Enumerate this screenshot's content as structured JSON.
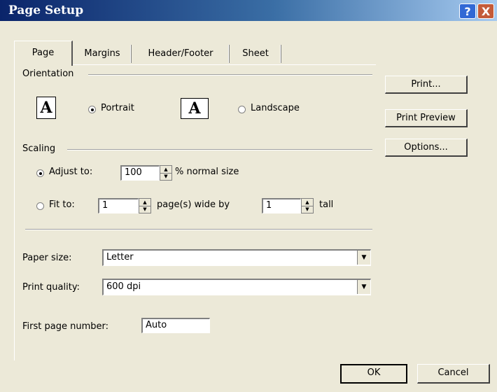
{
  "window": {
    "title": "Page Setup",
    "help_glyph": "?",
    "close_glyph": "X"
  },
  "tabs": [
    {
      "label": "Page",
      "active": true
    },
    {
      "label": "Margins"
    },
    {
      "label": "Header/Footer"
    },
    {
      "label": "Sheet"
    }
  ],
  "orientation": {
    "group_label": "Orientation",
    "icon_letter": "A",
    "portrait_label": "Portrait",
    "landscape_label": "Landscape",
    "selected": "Portrait"
  },
  "scaling": {
    "group_label": "Scaling",
    "adjust_label": "Adjust to:",
    "adjust_value": "100",
    "adjust_suffix": "% normal size",
    "fit_label": "Fit to:",
    "fit_wide_value": "1",
    "fit_wide_suffix": "page(s) wide by",
    "fit_tall_value": "1",
    "fit_tall_suffix": "tall",
    "selected": "Adjust to:"
  },
  "paper_size": {
    "label": "Paper size:",
    "value": "Letter"
  },
  "print_quality": {
    "label": "Print quality:",
    "value": "600 dpi"
  },
  "first_page_number": {
    "label": "First page number:",
    "value": "Auto"
  },
  "side_buttons": {
    "print": "Print...",
    "print_preview": "Print Preview",
    "options": "Options..."
  },
  "footer_buttons": {
    "ok": "OK",
    "cancel": "Cancel"
  },
  "colors": {
    "titlebar_start": "#0a246a",
    "titlebar_end": "#a6caf0",
    "dialog_bg": "#ece9d8"
  }
}
